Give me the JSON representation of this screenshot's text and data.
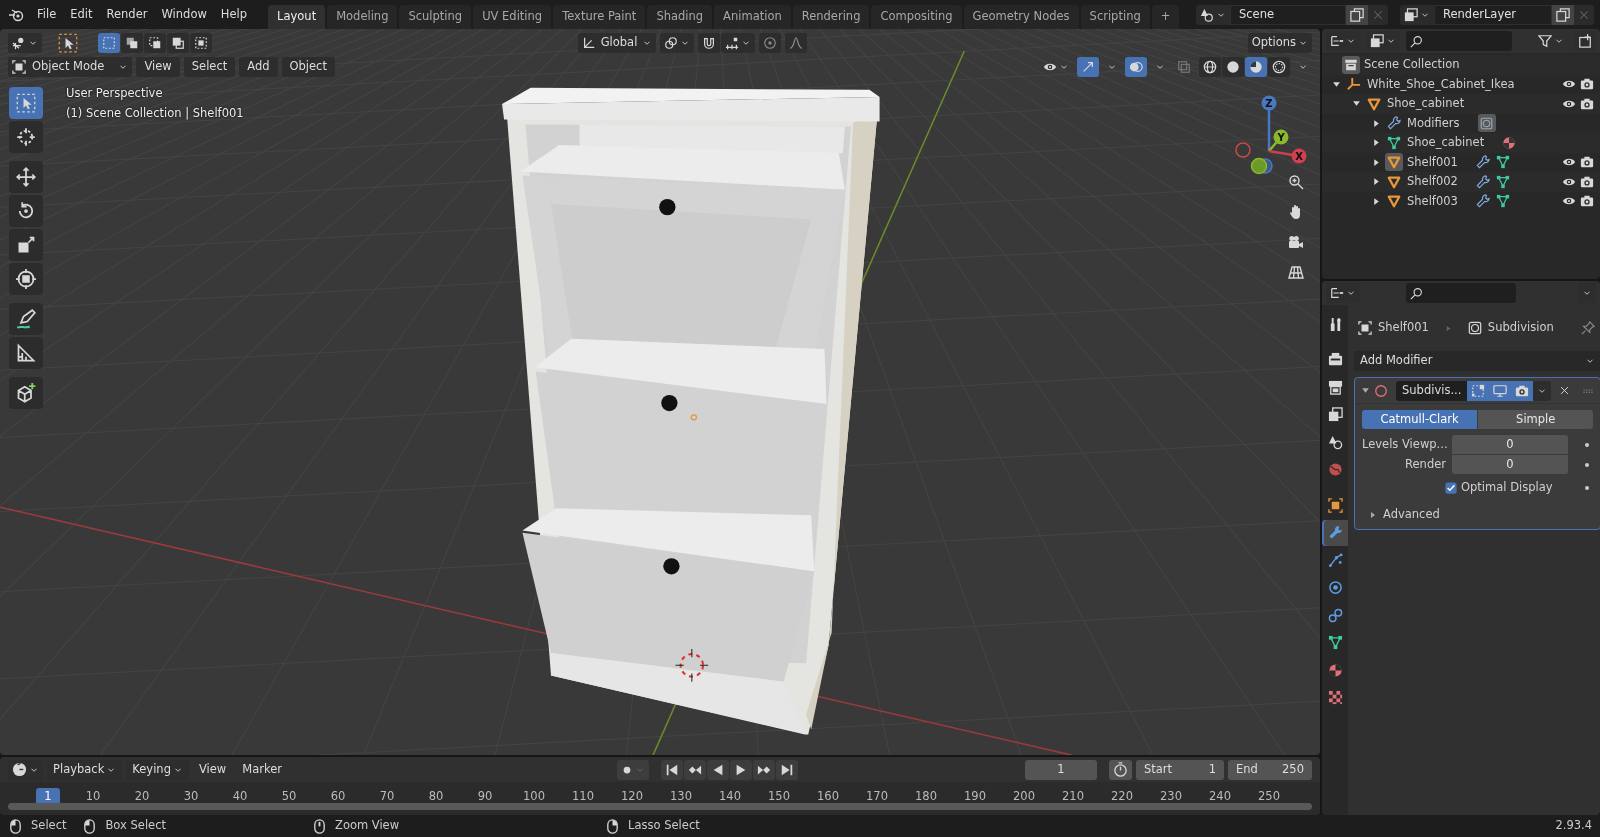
{
  "menu": [
    "File",
    "Edit",
    "Render",
    "Window",
    "Help"
  ],
  "workspaces": [
    {
      "label": "Layout",
      "selected": true
    },
    {
      "label": "Modeling",
      "selected": false
    },
    {
      "label": "Sculpting",
      "selected": false
    },
    {
      "label": "UV Editing",
      "selected": false
    },
    {
      "label": "Texture Paint",
      "selected": false
    },
    {
      "label": "Shading",
      "selected": false
    },
    {
      "label": "Animation",
      "selected": false
    },
    {
      "label": "Rendering",
      "selected": false
    },
    {
      "label": "Compositing",
      "selected": false
    },
    {
      "label": "Geometry Nodes",
      "selected": false
    },
    {
      "label": "Scripting",
      "selected": false
    }
  ],
  "add_workspace": "+",
  "scene": "Scene",
  "view_layer": "RenderLayer",
  "viewport": {
    "orientation": "Global",
    "options": "Options",
    "mode": "Object Mode",
    "menus": [
      "View",
      "Select",
      "Add",
      "Object"
    ],
    "select_modes": [
      {
        "kind": "set",
        "selected": true
      },
      {
        "kind": "extend",
        "selected": false
      },
      {
        "kind": "subtract",
        "selected": false
      },
      {
        "kind": "difference",
        "selected": false
      },
      {
        "kind": "intersect",
        "selected": false
      }
    ],
    "shading": [
      {
        "kind": "wireframe",
        "selected": false
      },
      {
        "kind": "solid",
        "selected": false
      },
      {
        "kind": "material",
        "selected": true
      },
      {
        "kind": "rendered",
        "selected": false
      }
    ],
    "overlay_text": [
      "User Perspective",
      "(1) Scene Collection | Shelf001"
    ],
    "tools": [
      {
        "kind": "select",
        "selected": true
      },
      {
        "kind": "cursor",
        "selected": false
      },
      {
        "kind": "move",
        "selected": false
      },
      {
        "kind": "rotate",
        "selected": false
      },
      {
        "kind": "scale",
        "selected": false
      },
      {
        "kind": "transform",
        "selected": false
      },
      {
        "kind": "annotate",
        "selected": false
      },
      {
        "kind": "measure",
        "selected": false
      },
      {
        "kind": "add_cube",
        "selected": false
      }
    ],
    "gizmo": {
      "x": "X",
      "y": "Y",
      "z": "Z"
    }
  },
  "outliner": {
    "root": "Scene Collection",
    "items": [
      {
        "label": "White_Shoe_Cabinet_Ikea",
        "kind": "empty",
        "expanded": true,
        "active": false,
        "children": [
          {
            "label": "Shoe_cabinet",
            "kind": "object",
            "expanded": true,
            "active": false,
            "children": [
              {
                "label": "Modifiers",
                "kind": "modifiers",
                "expanded": false,
                "active": false
              },
              {
                "label": "Shoe_cabinet",
                "kind": "mesh",
                "expanded": false,
                "active": false
              },
              {
                "label": "Shelf001",
                "kind": "object",
                "expanded": false,
                "active": true
              },
              {
                "label": "Shelf002",
                "kind": "object",
                "expanded": false,
                "active": false
              },
              {
                "label": "Shelf003",
                "kind": "object",
                "expanded": false,
                "active": false
              }
            ]
          }
        ]
      }
    ]
  },
  "properties": {
    "tabs": [
      {
        "kind": "tool",
        "selected": false
      },
      {
        "kind": "render",
        "selected": false
      },
      {
        "kind": "output",
        "selected": false
      },
      {
        "kind": "view_layer",
        "selected": false
      },
      {
        "kind": "scene",
        "selected": false
      },
      {
        "kind": "world",
        "selected": false
      },
      {
        "kind": "object",
        "selected": false
      },
      {
        "kind": "modifiers",
        "selected": true
      },
      {
        "kind": "particles",
        "selected": false
      },
      {
        "kind": "physics",
        "selected": false
      },
      {
        "kind": "constraints",
        "selected": false
      },
      {
        "kind": "data",
        "selected": false
      },
      {
        "kind": "material",
        "selected": false
      },
      {
        "kind": "texture",
        "selected": false
      }
    ],
    "object": "Shelf001",
    "modifier_label": "Subdivision",
    "add_modifier": "Add Modifier",
    "modifier": {
      "name": "Subdivis...",
      "expanded": true,
      "edit_mode": true,
      "viewport": true,
      "render": true,
      "methods": [
        {
          "label": "Catmull-Clark",
          "selected": true
        },
        {
          "label": "Simple",
          "selected": false
        }
      ],
      "fields": [
        {
          "label": "Levels Viewp...",
          "value": "0"
        },
        {
          "label": "Render",
          "value": "0"
        }
      ],
      "optimal_display": {
        "label": "Optimal Display",
        "checked": true
      },
      "advanced": {
        "label": "Advanced",
        "expanded": false
      }
    }
  },
  "timeline": {
    "menus": [
      {
        "label": "Playback",
        "dropdown": true
      },
      {
        "label": "Keying",
        "dropdown": true
      },
      {
        "label": "View",
        "dropdown": false
      },
      {
        "label": "Marker",
        "dropdown": false
      }
    ],
    "current_frame": "1",
    "start_label": "Start",
    "start": "1",
    "end_label": "End",
    "end": "250",
    "ruler": {
      "current": "1",
      "ticks": [
        "10",
        "20",
        "30",
        "40",
        "50",
        "60",
        "70",
        "80",
        "90",
        "100",
        "110",
        "120",
        "130",
        "140",
        "150",
        "160",
        "170",
        "180",
        "190",
        "200",
        "210",
        "220",
        "230",
        "240",
        "250"
      ]
    }
  },
  "status": {
    "hints": [
      {
        "kind": "left",
        "label": "Select"
      },
      {
        "kind": "left_drag",
        "label": "Box Select"
      },
      {
        "kind": "middle",
        "label": "Zoom View"
      },
      {
        "kind": "right_drag",
        "label": "Lasso Select"
      }
    ],
    "version": "2.93.4"
  }
}
